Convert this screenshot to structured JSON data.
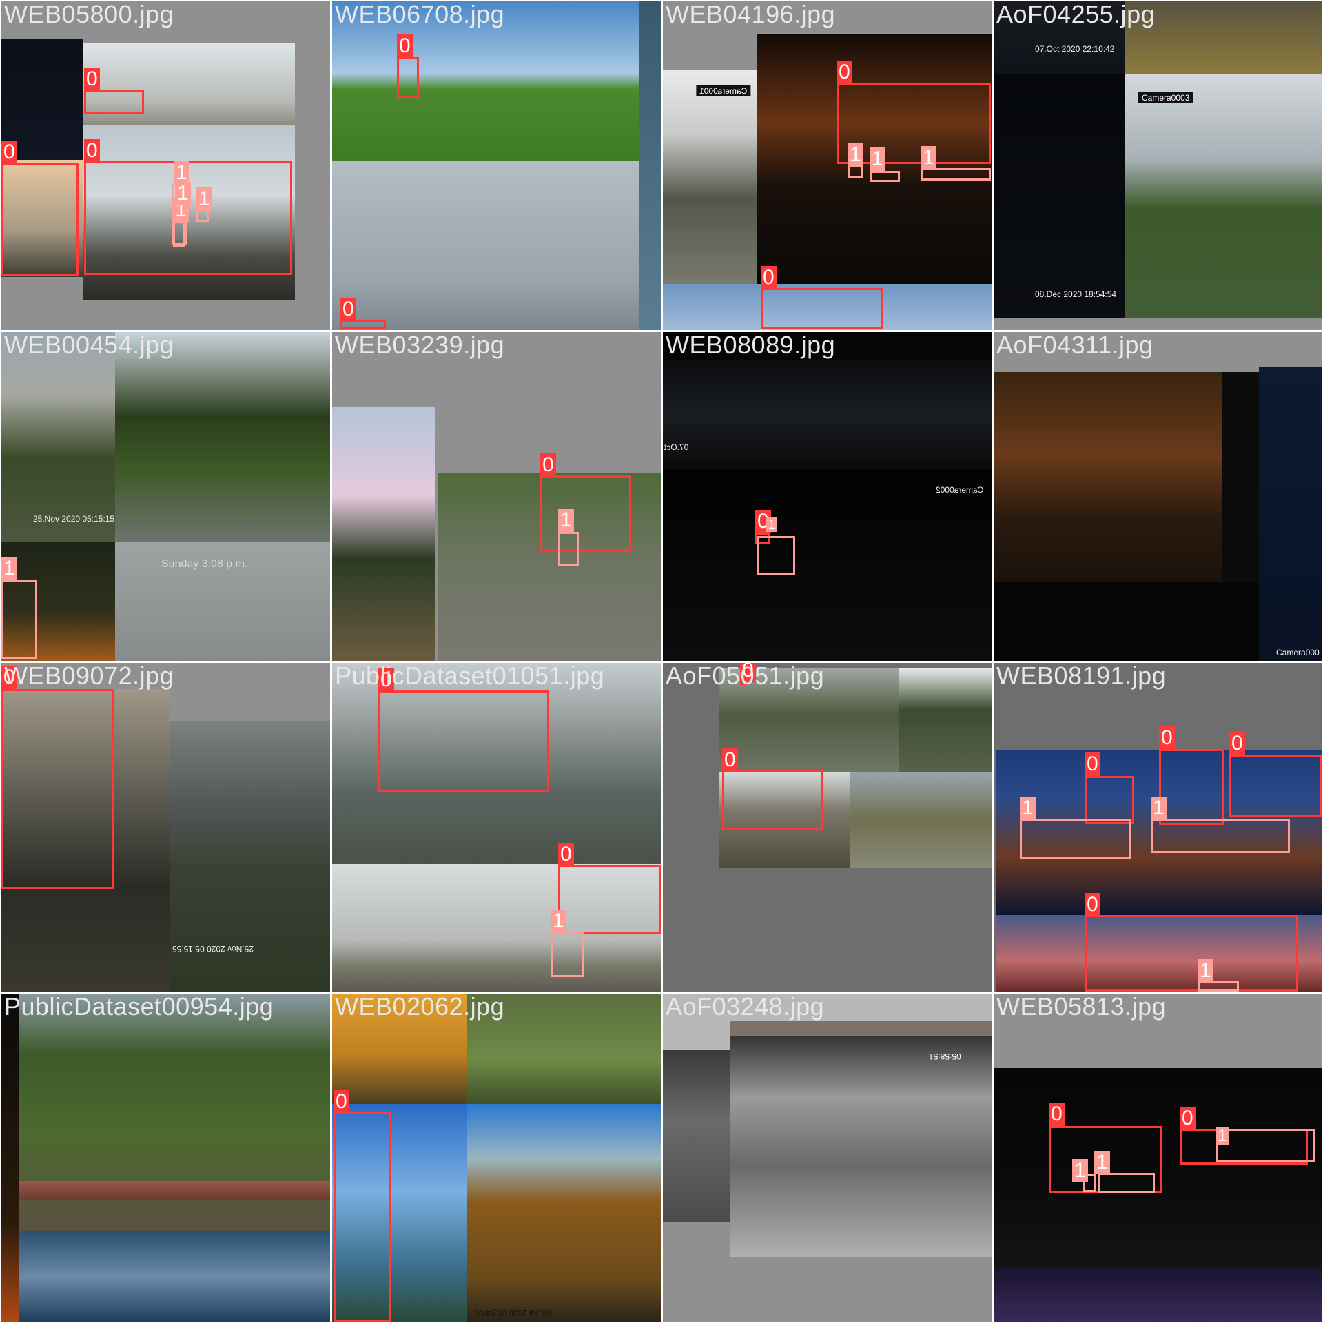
{
  "tiles": [
    {
      "id": "t0",
      "filename": "WEB05800.jpg",
      "row": 0,
      "col": 0,
      "labels": [
        {
          "cls": "0"
        },
        {
          "cls": "0"
        },
        {
          "cls": "0"
        },
        {
          "cls": "1"
        },
        {
          "cls": "1"
        },
        {
          "cls": "1"
        },
        {
          "cls": "1"
        }
      ],
      "text": []
    },
    {
      "id": "t1",
      "filename": "WEB06708.jpg",
      "row": 0,
      "col": 1,
      "labels": [
        {
          "cls": "0"
        },
        {
          "cls": "0"
        }
      ],
      "text": []
    },
    {
      "id": "t2",
      "filename": "WEB04196.jpg",
      "row": 0,
      "col": 2,
      "labels": [
        {
          "cls": "0"
        },
        {
          "cls": "1"
        },
        {
          "cls": "1"
        },
        {
          "cls": "1"
        },
        {
          "cls": "0"
        }
      ],
      "text": [
        "Camera0001"
      ]
    },
    {
      "id": "t3",
      "filename": "AoF04255.jpg",
      "row": 0,
      "col": 3,
      "labels": [],
      "text": [
        "07.Oct 2020  22:10:42",
        "Camera0003",
        "08.Dec 2020  18:54:54"
      ]
    },
    {
      "id": "t4",
      "filename": "WEB00454.jpg",
      "row": 1,
      "col": 0,
      "labels": [
        {
          "cls": "1"
        }
      ],
      "text": [
        "25.Nov 2020  05:15:15",
        "Sunday 3:08 p.m."
      ]
    },
    {
      "id": "t5",
      "filename": "WEB03239.jpg",
      "row": 1,
      "col": 1,
      "labels": [
        {
          "cls": "0"
        },
        {
          "cls": "1"
        }
      ],
      "text": []
    },
    {
      "id": "t6",
      "filename": "WEB08089.jpg",
      "row": 1,
      "col": 2,
      "labels": [
        {
          "cls": "0"
        },
        {
          "cls": "1"
        }
      ],
      "text": [
        "Camera0002",
        "07.Oct"
      ]
    },
    {
      "id": "t7",
      "filename": "AoF04311.jpg",
      "row": 1,
      "col": 3,
      "labels": [],
      "text": [
        "Camera000"
      ]
    },
    {
      "id": "t8",
      "filename": "WEB09072.jpg",
      "row": 2,
      "col": 0,
      "labels": [
        {
          "cls": "0"
        }
      ],
      "text": [
        "25.Nov 2020  05:15:55"
      ]
    },
    {
      "id": "t9",
      "filename": "PublicDataset01051.jpg",
      "row": 2,
      "col": 1,
      "labels": [
        {
          "cls": "0"
        },
        {
          "cls": "0"
        },
        {
          "cls": "1"
        }
      ],
      "text": []
    },
    {
      "id": "t10",
      "filename": "AoF05051.jpg",
      "row": 2,
      "col": 2,
      "labels": [
        {
          "cls": "0"
        },
        {
          "cls": "0"
        }
      ],
      "text": []
    },
    {
      "id": "t11",
      "filename": "WEB08191.jpg",
      "row": 2,
      "col": 3,
      "labels": [
        {
          "cls": "0"
        },
        {
          "cls": "0"
        },
        {
          "cls": "0"
        },
        {
          "cls": "1"
        },
        {
          "cls": "1"
        },
        {
          "cls": "0"
        },
        {
          "cls": "1"
        }
      ],
      "text": []
    },
    {
      "id": "t12",
      "filename": "PublicDataset00954.jpg",
      "row": 3,
      "col": 0,
      "labels": [],
      "text": []
    },
    {
      "id": "t13",
      "filename": "WEB02062.jpg",
      "row": 3,
      "col": 1,
      "labels": [
        {
          "cls": "0"
        }
      ],
      "text": [
        "06.Jul 2020  05:54:08"
      ]
    },
    {
      "id": "t14",
      "filename": "AoF03248.jpg",
      "row": 3,
      "col": 2,
      "labels": [],
      "text": [
        "05:58:51"
      ]
    },
    {
      "id": "t15",
      "filename": "WEB05813.jpg",
      "row": 3,
      "col": 3,
      "labels": [
        {
          "cls": "0"
        },
        {
          "cls": "1"
        },
        {
          "cls": "1"
        },
        {
          "cls": "0"
        },
        {
          "cls": "1"
        }
      ],
      "text": []
    }
  ],
  "colors": {
    "class0": "#ff3838",
    "class1": "#ff9d97",
    "background": "#909090"
  }
}
